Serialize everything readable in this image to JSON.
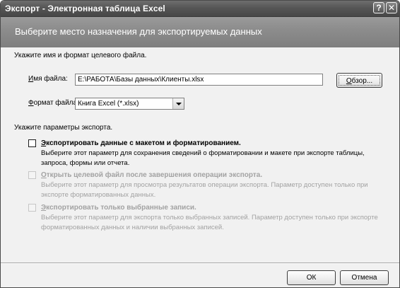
{
  "window": {
    "title": "Экспорт - Электронная таблица Excel",
    "help_glyph": "?",
    "close_glyph": "✕"
  },
  "banner": {
    "heading": "Выберите место назначения для экспортируемых данных"
  },
  "file_section": {
    "instruction": "Укажите имя и формат целевого файла.",
    "filename_label_mnemonic": "И",
    "filename_label_rest": "мя файла:",
    "filename_value": "E:\\РАБОТА\\Базы данных\\Клиенты.xlsx",
    "browse_label_mnemonic": "О",
    "browse_label_rest": "бзор...",
    "format_label_mnemonic": "Ф",
    "format_label_rest": "ормат файла:",
    "format_value": "Книга Excel (*.xlsx)"
  },
  "export_options": {
    "instruction": "Укажите параметры экспорта.",
    "options": [
      {
        "title_mnemonic": "Э",
        "title_rest": "кспортировать данные с макетом и форматированием.",
        "description": "Выберите этот параметр для сохранения сведений о форматировании и макете при экспорте таблицы, запроса, формы или отчета.",
        "checked": false,
        "enabled": true
      },
      {
        "title_mnemonic": "О",
        "title_rest": "ткрыть целевой файл после завершения операции экспорта.",
        "description": "Выберите этот параметр для просмотра результатов операции экспорта. Параметр доступен только при экспорте форматированных данных.",
        "checked": false,
        "enabled": false
      },
      {
        "title_mnemonic": "Э",
        "title_rest": "кспортировать только выбранные записи.",
        "description": "Выберите этот параметр для экспорта только выбранных записей. Параметр доступен только при экспорте форматированных данных и наличии выбранных записей.",
        "checked": false,
        "enabled": false
      }
    ]
  },
  "footer": {
    "ok_label": "ОК",
    "cancel_label": "Отмена"
  }
}
